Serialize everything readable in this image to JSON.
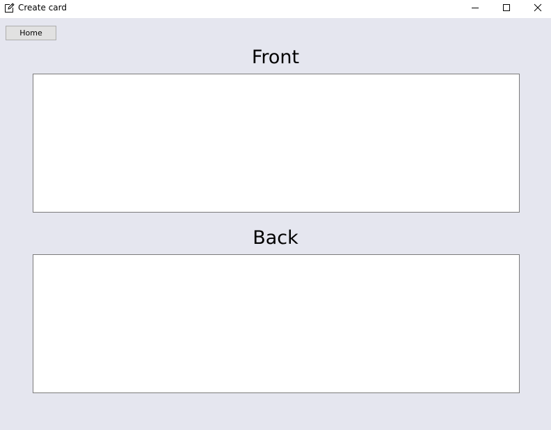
{
  "window": {
    "title": "Create card"
  },
  "toolbar": {
    "home_label": "Home"
  },
  "front": {
    "heading": "Front",
    "value": ""
  },
  "back": {
    "heading": "Back",
    "value": ""
  },
  "icons": {
    "app": "edit-icon",
    "minimize": "minimize-icon",
    "maximize": "maximize-icon",
    "close": "close-icon"
  }
}
